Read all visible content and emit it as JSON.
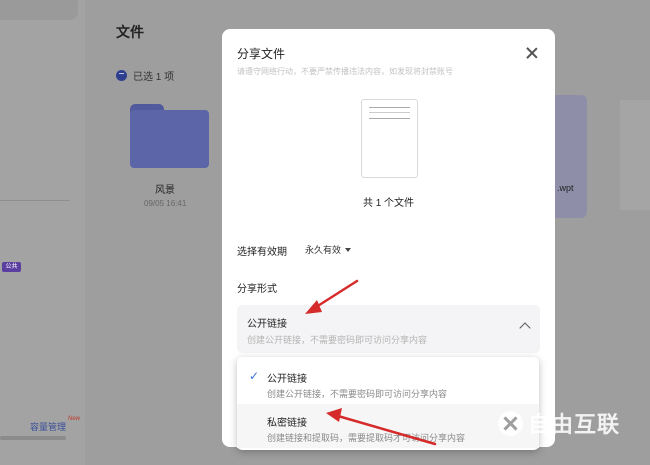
{
  "background": {
    "badge_label": "公共",
    "capacity_link": "容量管理",
    "capacity_new": "New",
    "page_title": "文件",
    "selected_text": "已选 1 项",
    "folder_name": "风景",
    "folder_date": "09/05 16:41",
    "file_ext": ".wpt"
  },
  "modal": {
    "title": "分享文件",
    "subtitle": "请遵守网络行动，不要严禁传播违法内容，如发现将封禁账号",
    "file_count": "共 1 个文件",
    "validity_label": "选择有效期",
    "validity_value": "永久有效",
    "share_form_label": "分享形式",
    "share_select": {
      "title": "公开链接",
      "desc": "创建公开链接，不需要密码即可访问分享内容"
    }
  },
  "dropdown": {
    "options": [
      {
        "title": "公开链接",
        "desc": "创建公开链接，不需要密码即可访问分享内容",
        "check": "✓"
      },
      {
        "title": "私密链接",
        "desc": "创建链接和提取码，需要提取码才可访问分享内容"
      }
    ]
  },
  "watermark": "自由互联",
  "colors": {
    "arrow": "#d62b2b",
    "check": "#3b6fe0",
    "accent": "#2e3f8f"
  }
}
